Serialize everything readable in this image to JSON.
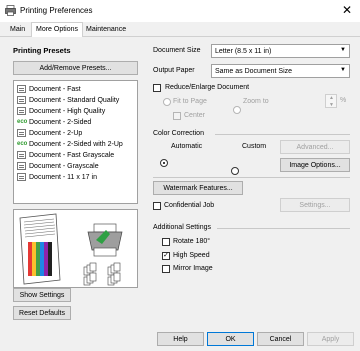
{
  "window": {
    "title": "Printing Preferences",
    "close_glyph": "✕"
  },
  "tabs": [
    {
      "label": "Main"
    },
    {
      "label": "More Options"
    },
    {
      "label": "Maintenance"
    }
  ],
  "presets": {
    "heading": "Printing Presets",
    "add_remove_label": "Add/Remove Presets...",
    "items": [
      {
        "label": "Document - Fast",
        "icon": "document-icon"
      },
      {
        "label": "Document - Standard Quality",
        "icon": "document-icon"
      },
      {
        "label": "Document - High Quality",
        "icon": "document-icon"
      },
      {
        "label": "Document - 2-Sided",
        "icon": "eco-icon"
      },
      {
        "label": "Document - 2-Up",
        "icon": "document-icon"
      },
      {
        "label": "Document - 2-Sided with 2-Up",
        "icon": "eco-icon"
      },
      {
        "label": "Document - Fast Grayscale",
        "icon": "document-icon"
      },
      {
        "label": "Document - Grayscale",
        "icon": "document-icon"
      },
      {
        "label": "Document - 11 x 17 in",
        "icon": "document-icon"
      }
    ],
    "eco_text": "eco"
  },
  "left_buttons": {
    "show_settings": "Show Settings",
    "reset_defaults": "Reset Defaults"
  },
  "document_size": {
    "label": "Document Size",
    "value": "Letter (8.5 x 11 in)"
  },
  "output_paper": {
    "label": "Output Paper",
    "value": "Same as Document Size"
  },
  "reduce_enlarge": {
    "label": "Reduce/Enlarge Document",
    "fit_to_page": "Fit to Page",
    "zoom_to": "Zoom to",
    "center": "Center",
    "percent": "%"
  },
  "color_correction": {
    "heading": "Color Correction",
    "automatic": "Automatic",
    "custom": "Custom",
    "advanced": "Advanced...",
    "image_options": "Image Options..."
  },
  "watermark": {
    "features_label": "Watermark Features...",
    "confidential": "Confidential Job",
    "settings": "Settings..."
  },
  "additional": {
    "heading": "Additional Settings",
    "rotate": "Rotate 180°",
    "high_speed": "High Speed",
    "mirror": "Mirror Image",
    "check_glyph": "✓"
  },
  "dialog_buttons": {
    "ok": "OK",
    "cancel": "Cancel",
    "apply": "Apply",
    "help": "Help"
  }
}
